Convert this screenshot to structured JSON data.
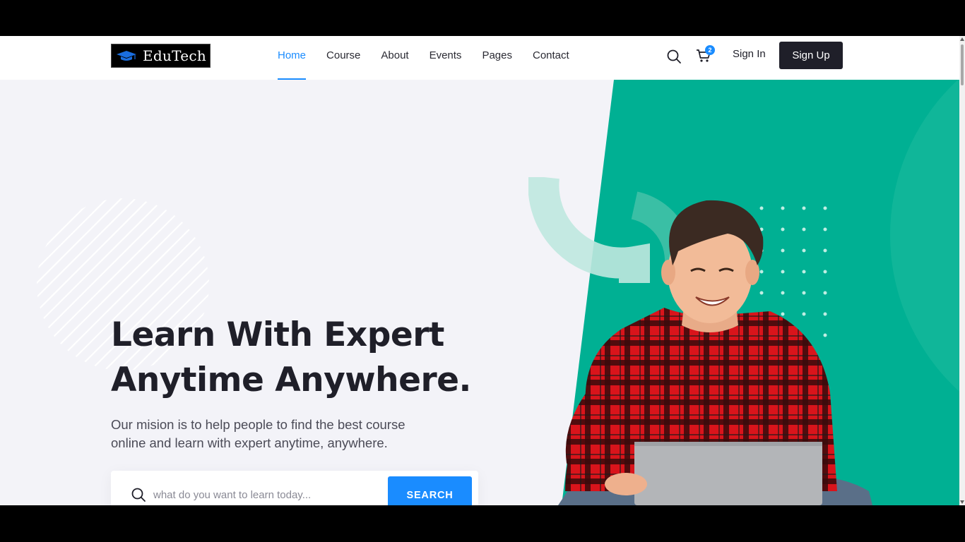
{
  "brand": {
    "name": "EduTech",
    "logo_icon": "graduation-cap-icon"
  },
  "nav": {
    "items": [
      {
        "label": "Home",
        "active": true
      },
      {
        "label": "Course",
        "active": false
      },
      {
        "label": "About",
        "active": false
      },
      {
        "label": "Events",
        "active": false
      },
      {
        "label": "Pages",
        "active": false
      },
      {
        "label": "Contact",
        "active": false
      }
    ]
  },
  "header": {
    "search_icon": "search-icon",
    "cart_icon": "shopping-cart-icon",
    "cart_count": "2",
    "signin_label": "Sign In",
    "signup_label": "Sign Up"
  },
  "hero": {
    "headline_line1": "Learn With Expert",
    "headline_line2": "Anytime Anywhere.",
    "subtext_line1": "Our mision is to help people to find the best course",
    "subtext_line2": "online and learn with expert anytime, anywhere.",
    "search_placeholder": "what do you want to learn today...",
    "search_button": "SEARCH"
  },
  "colors": {
    "accent": "#1a8cff",
    "green": "#00b093",
    "dark": "#1f1f29",
    "hero_bg": "#f3f3f8"
  }
}
